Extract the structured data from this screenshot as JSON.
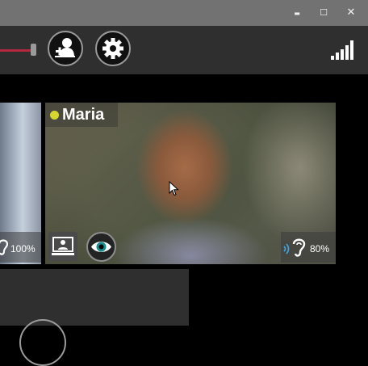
{
  "window": {
    "minimize_glyph": "▬",
    "maximize_glyph": "☐",
    "close_glyph": "✕"
  },
  "toolbar": {
    "slider_color": "#b3283f",
    "icons": [
      "add-contact-icon",
      "gear-icon",
      "signal-strength-icon"
    ]
  },
  "participants": [
    {
      "name": "",
      "volume": "100%",
      "icons": [
        "ear-icon"
      ]
    },
    {
      "name": "Maria",
      "status_color": "#d6d631",
      "volume": "80%",
      "icons": [
        "screen-share-icon",
        "eye-icon",
        "ear-icon",
        "speaker-waves-icon"
      ]
    }
  ]
}
